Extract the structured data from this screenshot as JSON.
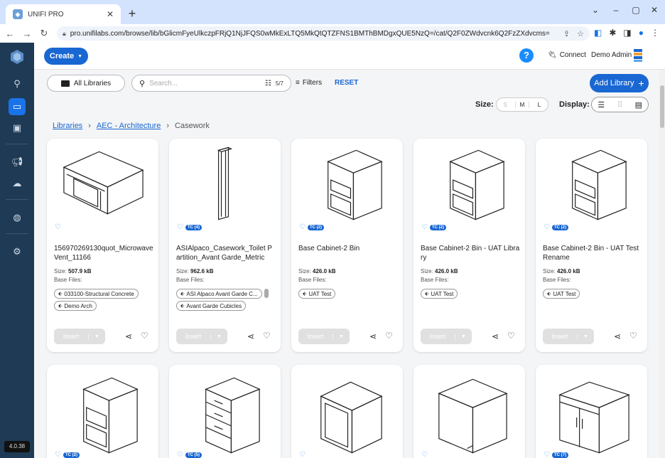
{
  "browser": {
    "tab_title": "UNIFI PRO",
    "url": "pro.unifilabs.com/browse/lib/bGlicmFyeUlkczpFRjQ1NjJFQS0wMkExLTQ5MkQtQTZFNS1BMThBMDgxQUE5NzQ=/cat/Q2F0ZWdvcnk6Q2FzZXdvcms="
  },
  "sidebar": {
    "version": "4.0.38"
  },
  "topbar": {
    "create_label": "Create",
    "connect_label": "Connect",
    "user_name": "Demo Admin"
  },
  "toolbar": {
    "all_libraries": "All Libraries",
    "search_placeholder": "Search...",
    "search_count": "5/7",
    "filters": "Filters",
    "reset": "RESET",
    "add_library": "Add Library"
  },
  "view": {
    "size_label": "Size:",
    "sizes": [
      "S",
      "M",
      "L"
    ],
    "display_label": "Display:"
  },
  "breadcrumb": [
    "Libraries",
    "AEC - Architecture",
    "Casework"
  ],
  "cards": [
    {
      "tc": "",
      "title": "156970269130quot_Microwave Vent_11166",
      "size_label": "Size:",
      "size": "507.9 kB",
      "base_files": "Base Files:",
      "tags": [
        "033100-Structural Concrete",
        "Demo Arch"
      ]
    },
    {
      "tc": "TC (4)",
      "title": "ASIAlpaco_Casework_Toilet Partition_Avant Garde_Metric",
      "size_label": "Size:",
      "size": "962.6 kB",
      "base_files": "Base Files:",
      "tags": [
        "ASI Alpaco Avant Garde C...",
        "Avant Garde Cubicles"
      ]
    },
    {
      "tc": "TC (2)",
      "title": "Base Cabinet-2 Bin",
      "size_label": "Size:",
      "size": "426.0 kB",
      "base_files": "Base Files:",
      "tags": [
        "UAT Test"
      ]
    },
    {
      "tc": "TC (2)",
      "title": "Base Cabinet-2 Bin - UAT Library",
      "size_label": "Size:",
      "size": "426.0 kB",
      "base_files": "Base Files:",
      "tags": [
        "UAT Test"
      ]
    },
    {
      "tc": "TC (2)",
      "title": "Base Cabinet-2 Bin - UAT Test Rename",
      "size_label": "Size:",
      "size": "426.0 kB",
      "base_files": "Base Files:",
      "tags": [
        "UAT Test"
      ]
    }
  ],
  "row2_badges": [
    "TC (2)",
    "TC (5)",
    "",
    "",
    "TC (7)"
  ],
  "insert_label": "Insert"
}
